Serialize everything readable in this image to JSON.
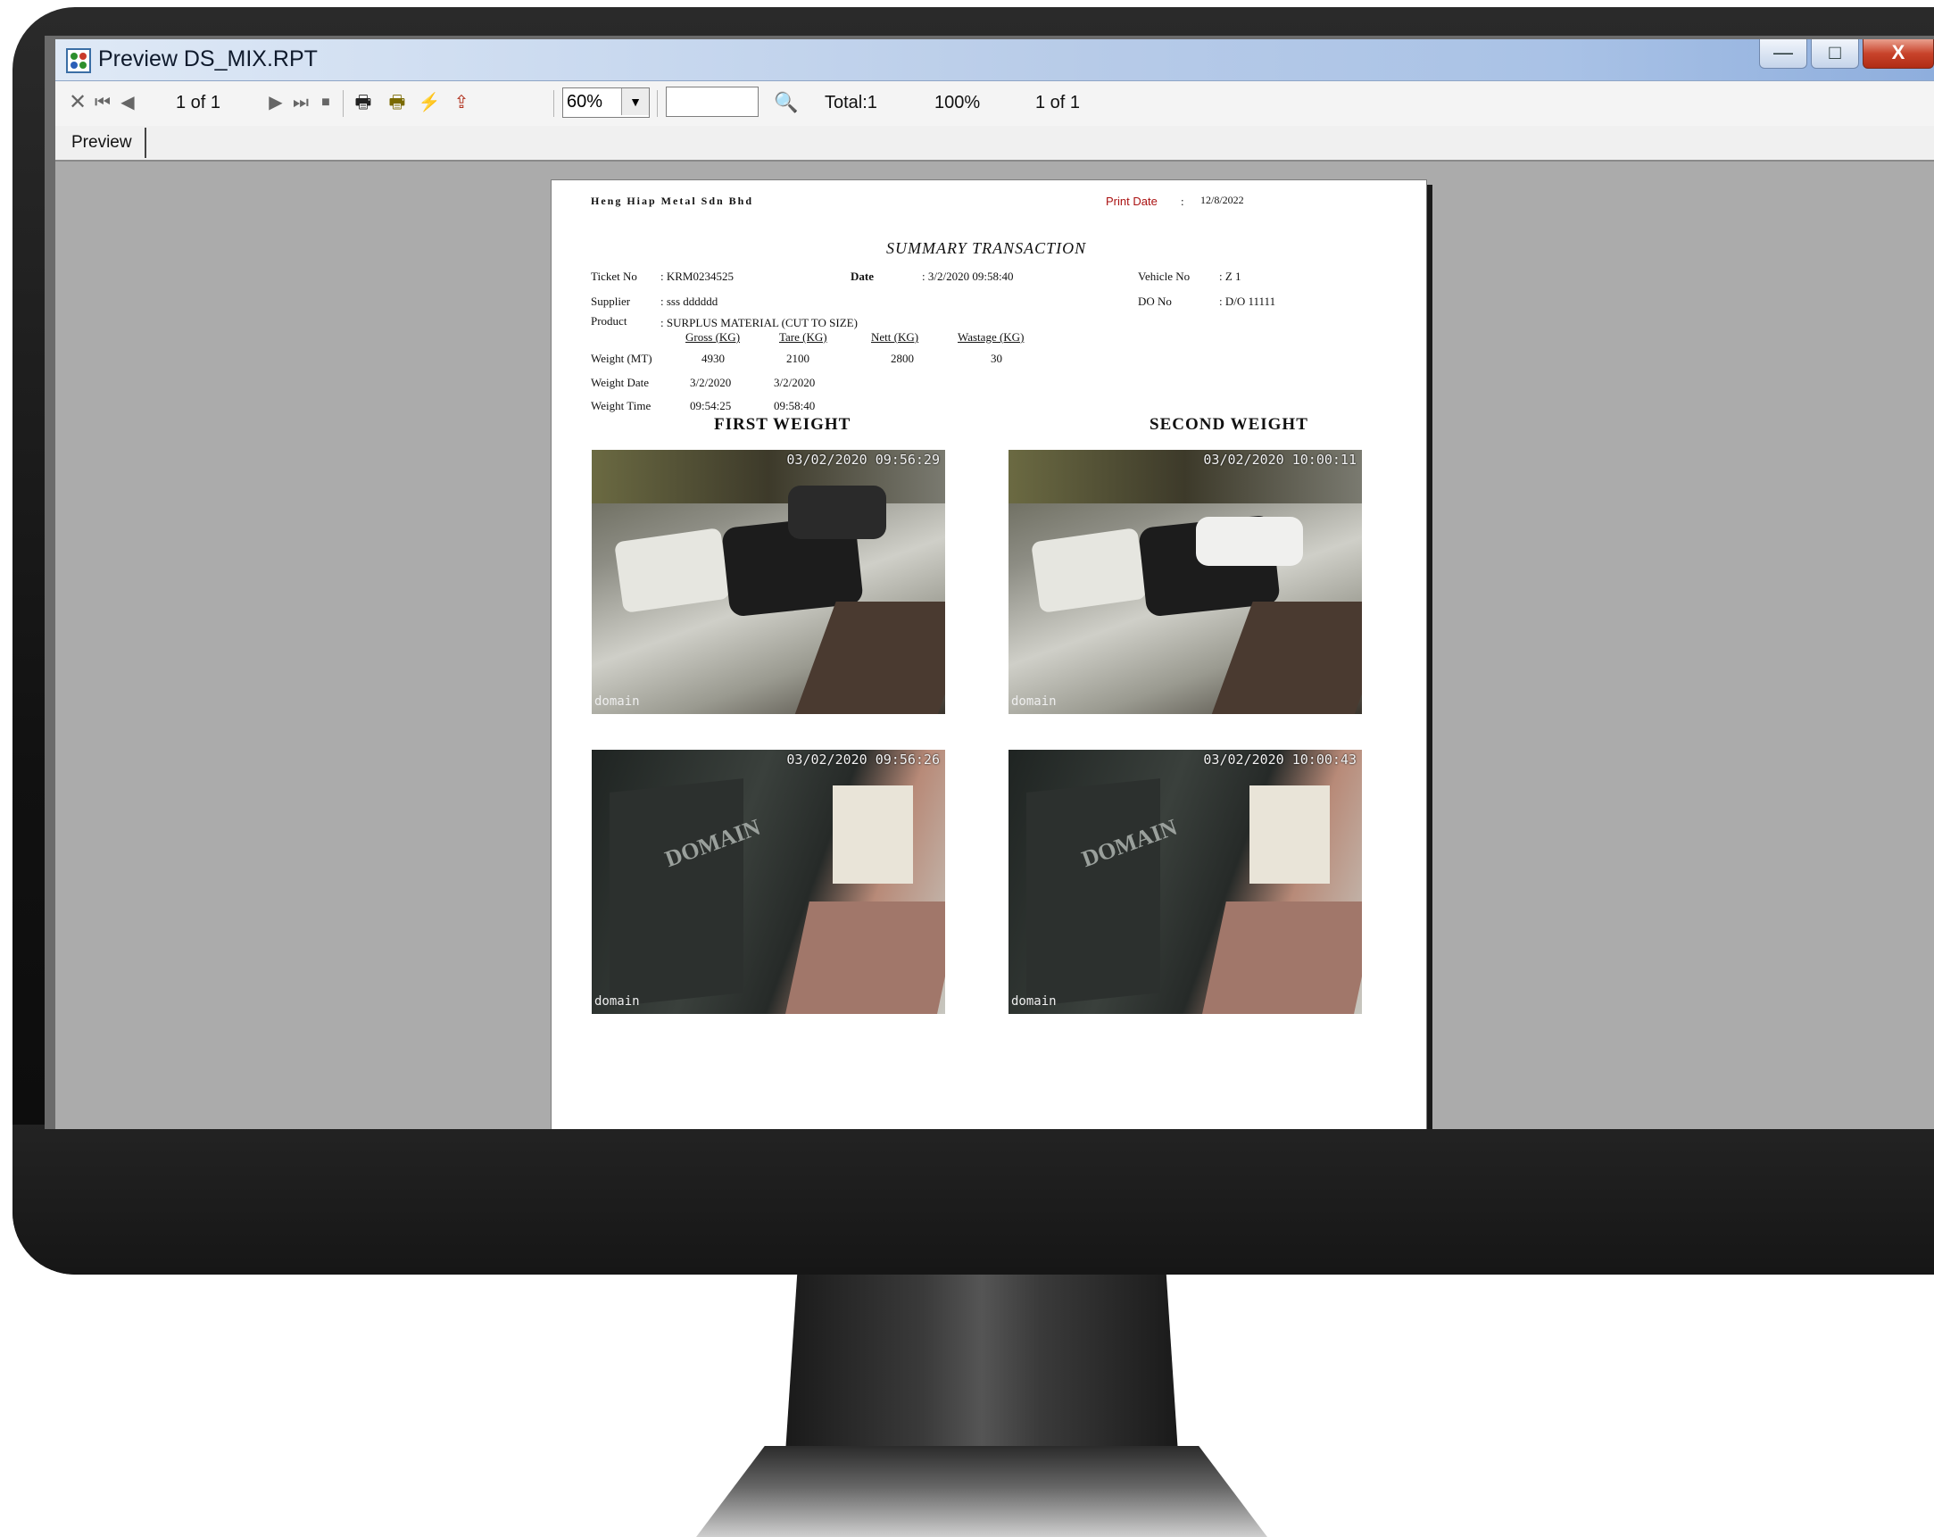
{
  "window": {
    "title": "Preview DS_MIX.RPT",
    "buttons": {
      "minimize": "—",
      "maximize": "□",
      "close": "X"
    }
  },
  "toolbar": {
    "page_indicator": "1 of 1",
    "zoom_value": "60%",
    "search_value": "",
    "total": "Total:1",
    "percent": "100%",
    "page_count": "1 of 1"
  },
  "tabs": {
    "preview": "Preview"
  },
  "report": {
    "company": "Heng Hiap Metal Sdn Bhd",
    "print_date_label": "Print Date",
    "print_date_colon": ":",
    "print_date_value": "12/8/2022",
    "heading": "SUMMARY TRANSACTION",
    "ticket_label": "Ticket No",
    "ticket_value": ": KRM0234525",
    "date_label": "Date",
    "date_value": ": 3/2/2020 09:58:40",
    "vehicle_label": "Vehicle No",
    "vehicle_value": ": Z 1",
    "supplier_label": "Supplier",
    "supplier_value": ": sss dddddd",
    "do_label": "DO No",
    "do_value": ": D/O 11111",
    "product_label": "Product",
    "product_value": ": SURPLUS MATERIAL (CUT TO SIZE)",
    "col_gross": "Gross (KG)",
    "col_tare": "Tare (KG)",
    "col_nett": "Nett (KG)",
    "col_wastage": "Wastage (KG)",
    "weight_label": "Weight (MT)",
    "weight_gross": "4930",
    "weight_tare": "2100",
    "weight_nett": "2800",
    "weight_wastage": "30",
    "wdate_label": "Weight Date",
    "wdate_first": "3/2/2020",
    "wdate_second": "3/2/2020",
    "wtime_label": "Weight Time",
    "wtime_first": "09:54:25",
    "wtime_second": "09:58:40",
    "first_weight_title": "FIRST WEIGHT",
    "second_weight_title": "SECOND WEIGHT",
    "photos": {
      "first_top_stamp": "03/02/2020 09:56:29",
      "second_top_stamp": "03/02/2020 10:00:11",
      "first_bottom_stamp": "03/02/2020 09:56:26",
      "second_bottom_stamp": "03/02/2020 10:00:43",
      "brand": "domain"
    }
  }
}
